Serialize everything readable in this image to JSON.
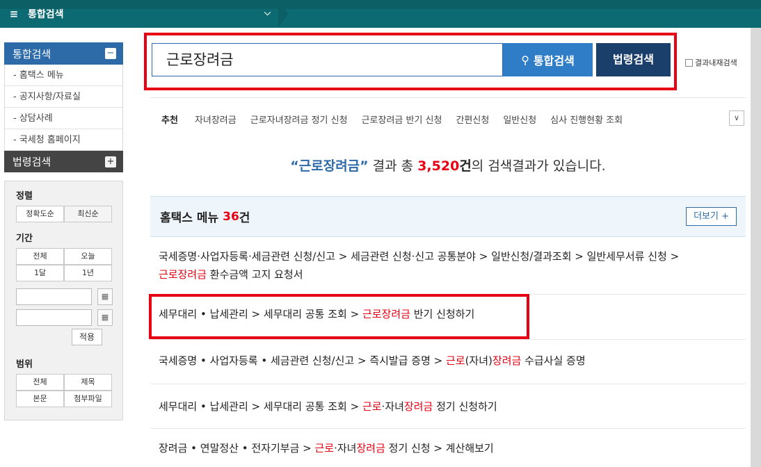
{
  "topbar": {
    "menu_label": "통합검색",
    "hamburger_icon": "≡",
    "chevron": "⌄"
  },
  "sidebar": {
    "unified": {
      "title": "통합검색",
      "toggle": "−"
    },
    "items": [
      "- 홈택스 메뉴",
      "- 공지사항/자료실",
      "- 상담사례",
      "- 국세청 홈페이지"
    ],
    "law": {
      "title": "법령검색",
      "toggle": "+"
    },
    "sort": {
      "title": "정렬",
      "options": [
        "정확도순",
        "최신순"
      ]
    },
    "period": {
      "title": "기간",
      "options": [
        "전체",
        "오늘",
        "1달",
        "1년"
      ],
      "apply": "적용"
    },
    "scope": {
      "title": "범위",
      "options": [
        "전체",
        "제목",
        "본문",
        "첨부파일"
      ]
    }
  },
  "search": {
    "query": "근로장려금",
    "unified_button": "통합검색",
    "law_button": "법령검색",
    "within_label": "결과내재검색"
  },
  "recommend": {
    "label": "추천",
    "keywords": [
      "자녀장려금",
      "근로자녀장려금 정기 신청",
      "근로장려금 반기 신청",
      "간편신청",
      "일반신청",
      "심사 진행현황 조회"
    ]
  },
  "summary": {
    "query": "“근로장려금”",
    "mid": " 결과 총 ",
    "count": "3,520",
    "unit": "건",
    "tail": "의 검색결과가 있습니다."
  },
  "section": {
    "title": "홈택스 메뉴",
    "count": "36",
    "unit": "건",
    "more": "더보기 +"
  },
  "results": [
    {
      "pre": "국세증명·사업자등록·세금관련 신청/신고 > 세금관련 신청·신고 공통분야 > 일반신청/결과조회 > 일반세무서류 신청 >",
      "line2_hl": "근로장려금",
      "line2_post": " 환수금액 고지 요청서"
    },
    {
      "pre": "세무대리 • 납세관리 > 세무대리 공통 조회 > ",
      "hl": "근로장려금",
      "post": " 반기 신청하기"
    },
    {
      "pre": "국세증명 • 사업자등록 • 세금관련 신청/신고 > 즉시발급 증명 > ",
      "hl1": "근로",
      "mid": "(자녀)",
      "hl2": "장려금",
      "post": " 수급사실 증명"
    },
    {
      "pre": "세무대리 • 납세관리 > 세무대리 공통 조회 > ",
      "hl1": "근로",
      "mid": "·자녀",
      "hl2": "장려금",
      "post": " 정기 신청하기"
    },
    {
      "pre": "장려금 • 연말정산 • 전자기부금 > ",
      "hl1": "근로",
      "mid": "·자녀",
      "hl2": "장려금",
      "post": " 정기 신청 > 계산해보기"
    }
  ],
  "colors": {
    "accent_blue": "#2d6aa8",
    "highlight_red": "#e60012",
    "topbar": "#0c6a72"
  }
}
